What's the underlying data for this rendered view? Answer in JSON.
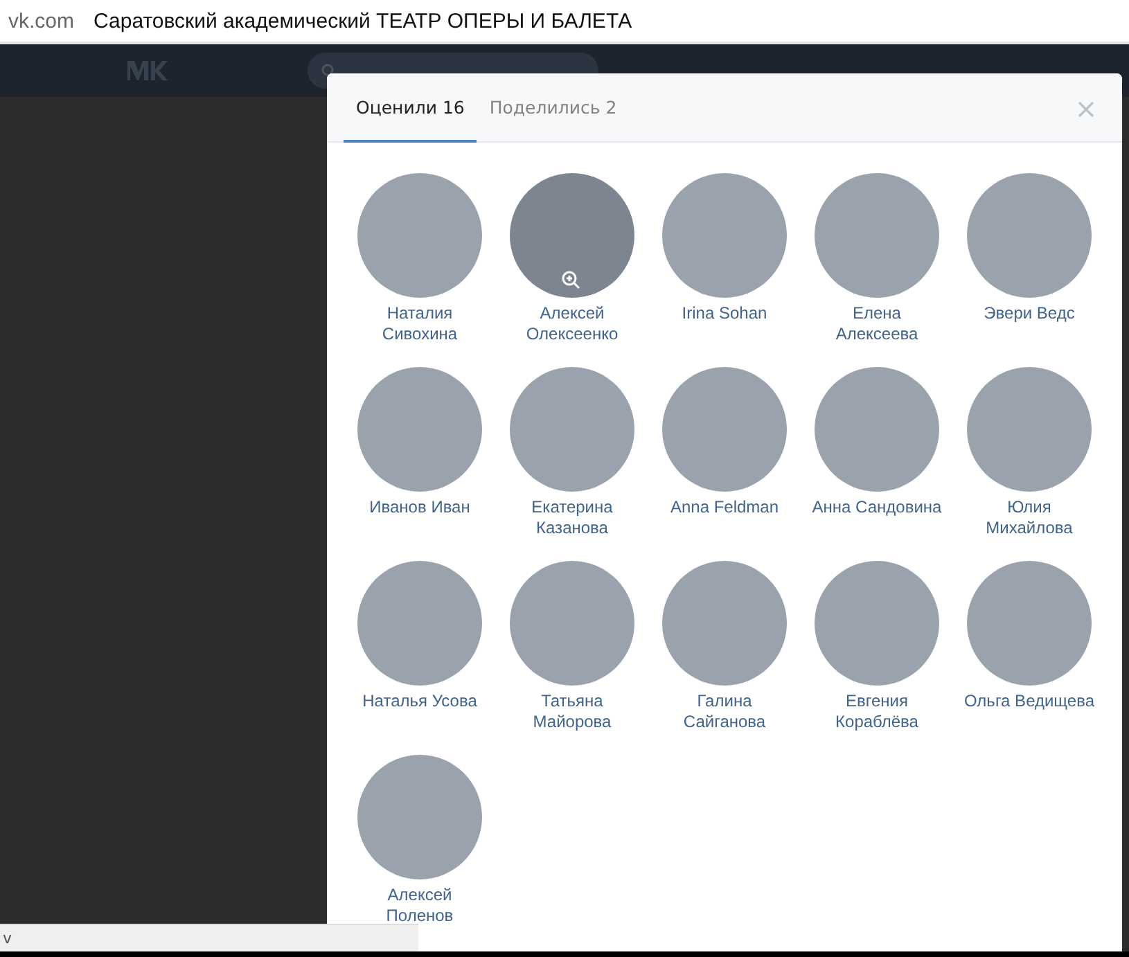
{
  "browser": {
    "domain": "vk.com",
    "title": "Саратовский академический ТЕАТР ОПЕРЫ И БАЛЕТА"
  },
  "modal": {
    "tabs": [
      {
        "label": "Оценили",
        "count": "16",
        "selected": true
      },
      {
        "label": "Поделились",
        "count": "2",
        "selected": false
      }
    ],
    "people": [
      {
        "name_lines": [
          "Наталия",
          "Сивохина"
        ],
        "hovered": false
      },
      {
        "name_lines": [
          "Алексей",
          "Олексеенко"
        ],
        "hovered": true
      },
      {
        "name_lines": [
          "Irina Sohan"
        ],
        "hovered": false
      },
      {
        "name_lines": [
          "Елена",
          "Алексеева"
        ],
        "hovered": false
      },
      {
        "name_lines": [
          "Эвери Ведс"
        ],
        "hovered": false
      },
      {
        "name_lines": [
          "Иванов Иван"
        ],
        "hovered": false
      },
      {
        "name_lines": [
          "Екатерина",
          "Казанова"
        ],
        "hovered": false
      },
      {
        "name_lines": [
          "Anna Feldman"
        ],
        "hovered": false
      },
      {
        "name_lines": [
          "Анна Сандовина"
        ],
        "hovered": false
      },
      {
        "name_lines": [
          "Юлия",
          "Михайлова"
        ],
        "hovered": false
      },
      {
        "name_lines": [
          "Наталья Усова"
        ],
        "hovered": false
      },
      {
        "name_lines": [
          "Татьяна",
          "Майорова"
        ],
        "hovered": false
      },
      {
        "name_lines": [
          "Галина",
          "Сайганова"
        ],
        "hovered": false
      },
      {
        "name_lines": [
          "Евгения",
          "Кораблёва"
        ],
        "hovered": false
      },
      {
        "name_lines": [
          "Ольга Ведищева"
        ],
        "hovered": false
      },
      {
        "name_lines": [
          "Алексей",
          "Поленов"
        ],
        "hovered": false
      }
    ]
  },
  "status_bar": {
    "text": "v"
  }
}
